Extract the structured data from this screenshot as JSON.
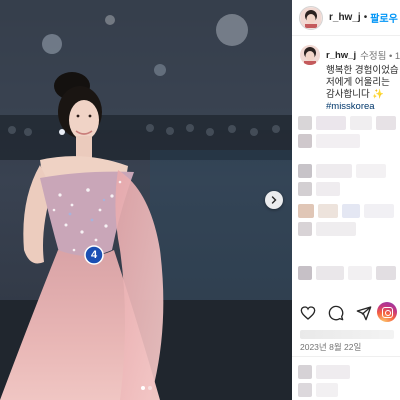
{
  "header": {
    "username": "r_hw_j",
    "separator": "•",
    "follow_label": "팔로우"
  },
  "caption": {
    "username": "r_hw_j",
    "edited": "수정됨 • 1",
    "lines": [
      "행복한 경험이었습",
      "저에게 어울리는",
      "감사합니다 ✨"
    ],
    "hashtag": "#misskorea"
  },
  "post": {
    "date": "2023년 8월 22일",
    "contestant_number": "4",
    "carousel_dots": 2,
    "active_dot": 0
  },
  "icons": {
    "like": "heart-icon",
    "comment": "comment-icon",
    "share": "send-icon",
    "save": "instagram-badge-icon",
    "next": "chevron-right-icon"
  },
  "colors": {
    "accent": "#0095f6",
    "hashtag": "#00376b",
    "muted": "#737373",
    "gown": "#e8b5b4"
  }
}
